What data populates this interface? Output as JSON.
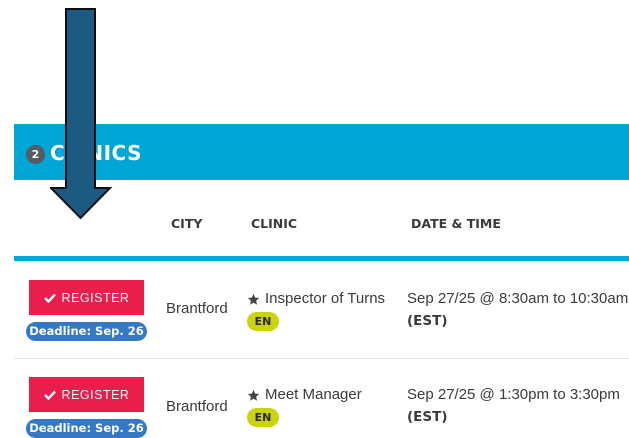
{
  "section": {
    "count": "2",
    "title": "CLINICS"
  },
  "table": {
    "headers": {
      "city": "CITY",
      "clinic": "CLINIC",
      "datetime": "DATE & TIME"
    },
    "rows": [
      {
        "register_label": "REGISTER",
        "deadline": "Deadline: Sep. 26",
        "city": "Brantford",
        "clinic": "Inspector of Turns",
        "language": "EN",
        "datetime": "Sep 27/25 @ 8:30am to 10:30am",
        "timezone": "(EST)"
      },
      {
        "register_label": "REGISTER",
        "deadline": "Deadline: Sep. 26",
        "city": "Brantford",
        "clinic": "Meet Manager",
        "language": "EN",
        "datetime": "Sep 27/25 @ 1:30pm to 3:30pm",
        "timezone": "(EST)"
      }
    ]
  },
  "icons": {
    "register": "check-icon",
    "clinic": "star-icon",
    "annotation": "down-arrow-icon"
  },
  "colors": {
    "banner": "#00a6d6",
    "register_button": "#e91e4c",
    "deadline_badge": "#3579c4",
    "language_badge": "#c9d30f",
    "annotation_arrow": "#1d5a82"
  }
}
